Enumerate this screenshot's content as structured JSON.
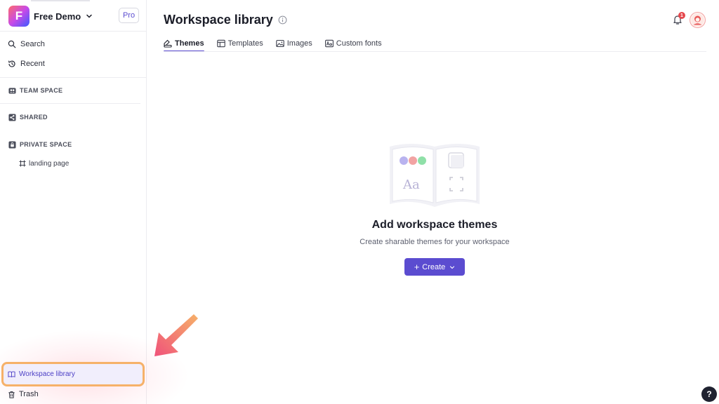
{
  "workspace": {
    "logo_letter": "F",
    "name": "Free Demo",
    "plan": "Pro"
  },
  "sidebar": {
    "search": "Search",
    "recent": "Recent",
    "team_space": "TEAM SPACE",
    "shared": "SHARED",
    "private_space": "PRIVATE SPACE",
    "private_pages": [
      "landing page"
    ],
    "workspace_library": "Workspace library",
    "trash": "Trash"
  },
  "header": {
    "title": "Workspace library",
    "notification_count": "1"
  },
  "tabs": [
    {
      "label": "Themes",
      "active": true,
      "icon": "theme-icon"
    },
    {
      "label": "Templates",
      "active": false,
      "icon": "template-icon"
    },
    {
      "label": "Images",
      "active": false,
      "icon": "image-icon"
    },
    {
      "label": "Custom fonts",
      "active": false,
      "icon": "font-icon"
    }
  ],
  "empty_state": {
    "illustration_text": "Aa",
    "title": "Add workspace themes",
    "subtitle": "Create sharable themes for your workspace",
    "create_label": "Create"
  },
  "help": {
    "label": "?"
  },
  "colors": {
    "accent": "#5b4cd0",
    "highlight_border": "#f6b169",
    "badge": "#e5484d"
  }
}
